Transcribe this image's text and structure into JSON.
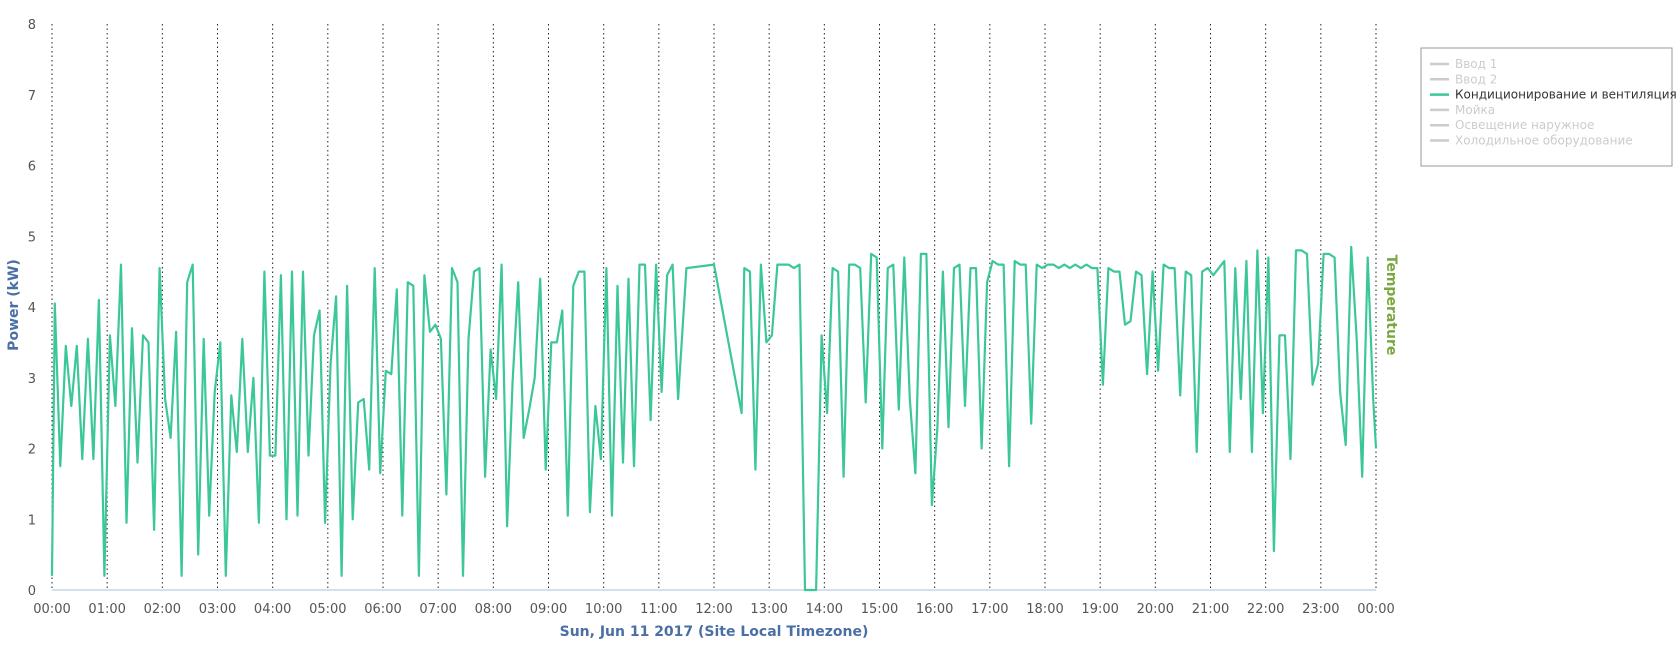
{
  "chart_data": {
    "type": "line",
    "xlabel": "Sun, Jun 11 2017 (Site Local Timezone)",
    "ylabel": "Power (kW)",
    "y2label": "Temperature",
    "ylim": [
      0,
      8
    ],
    "yticks": [
      "0",
      "1",
      "2",
      "3",
      "4",
      "5",
      "6",
      "7",
      "8"
    ],
    "xticks": [
      "00:00",
      "01:00",
      "02:00",
      "03:00",
      "04:00",
      "05:00",
      "06:00",
      "07:00",
      "08:00",
      "09:00",
      "10:00",
      "11:00",
      "12:00",
      "13:00",
      "14:00",
      "15:00",
      "16:00",
      "17:00",
      "18:00",
      "19:00",
      "20:00",
      "21:00",
      "22:00",
      "23:00",
      "00:00"
    ],
    "xlim_hours": [
      0,
      24
    ],
    "grid": "vertical dotted at each hour",
    "legend": {
      "position": "top-right",
      "entries": [
        {
          "name": "Ввод 1",
          "active": false
        },
        {
          "name": "Ввод 2",
          "active": false
        },
        {
          "name": "Кондиционирование и вентиляция",
          "active": true
        },
        {
          "name": "Мойка",
          "active": false
        },
        {
          "name": "Освещение наружное",
          "active": false
        },
        {
          "name": "Холодильное оборудование",
          "active": false
        }
      ]
    },
    "series": [
      {
        "name": "Кондиционирование и вентиляция",
        "color": "#3cc79a",
        "x_hours": [
          0.0,
          0.05,
          0.15,
          0.25,
          0.35,
          0.45,
          0.55,
          0.65,
          0.75,
          0.85,
          0.95,
          1.05,
          1.15,
          1.25,
          1.35,
          1.45,
          1.55,
          1.65,
          1.75,
          1.85,
          1.95,
          2.05,
          2.15,
          2.25,
          2.35,
          2.45,
          2.55,
          2.65,
          2.75,
          2.85,
          2.95,
          3.05,
          3.15,
          3.25,
          3.35,
          3.45,
          3.55,
          3.65,
          3.75,
          3.85,
          3.95,
          4.05,
          4.15,
          4.25,
          4.35,
          4.45,
          4.55,
          4.65,
          4.75,
          4.85,
          4.95,
          5.05,
          5.15,
          5.25,
          5.35,
          5.45,
          5.55,
          5.65,
          5.75,
          5.85,
          5.95,
          6.05,
          6.15,
          6.25,
          6.35,
          6.45,
          6.55,
          6.65,
          6.75,
          6.85,
          6.95,
          7.05,
          7.15,
          7.25,
          7.35,
          7.45,
          7.55,
          7.65,
          7.75,
          7.85,
          7.95,
          8.05,
          8.15,
          8.25,
          8.35,
          8.45,
          8.55,
          8.65,
          8.75,
          8.85,
          8.95,
          9.05,
          9.15,
          9.25,
          9.35,
          9.45,
          9.55,
          9.65,
          9.75,
          9.85,
          9.95,
          10.05,
          10.15,
          10.25,
          10.35,
          10.45,
          10.55,
          10.65,
          10.75,
          10.85,
          10.95,
          11.05,
          11.15,
          11.25,
          11.35,
          11.5,
          12.0,
          12.5,
          12.55,
          12.65,
          12.75,
          12.85,
          12.95,
          13.05,
          13.15,
          13.25,
          13.35,
          13.45,
          13.55,
          13.65,
          13.75,
          13.85,
          13.95,
          14.05,
          14.15,
          14.25,
          14.35,
          14.45,
          14.55,
          14.65,
          14.75,
          14.85,
          14.95,
          15.05,
          15.15,
          15.25,
          15.35,
          15.45,
          15.55,
          15.65,
          15.75,
          15.85,
          15.95,
          16.05,
          16.15,
          16.25,
          16.35,
          16.45,
          16.55,
          16.65,
          16.75,
          16.85,
          16.95,
          17.05,
          17.15,
          17.25,
          17.35,
          17.45,
          17.55,
          17.65,
          17.75,
          17.85,
          17.95,
          18.05,
          18.15,
          18.25,
          18.35,
          18.45,
          18.55,
          18.65,
          18.75,
          18.85,
          18.95,
          19.05,
          19.15,
          19.25,
          19.35,
          19.45,
          19.55,
          19.65,
          19.75,
          19.85,
          19.95,
          20.05,
          20.15,
          20.25,
          20.35,
          20.45,
          20.55,
          20.65,
          20.75,
          20.85,
          20.95,
          21.05,
          21.15,
          21.25,
          21.35,
          21.45,
          21.55,
          21.65,
          21.75,
          21.85,
          21.95,
          22.05,
          22.15,
          22.25,
          22.35,
          22.45,
          22.55,
          22.65,
          22.75,
          22.85,
          22.95,
          23.05,
          23.15,
          23.25,
          23.35,
          23.45,
          23.55,
          23.65,
          23.75,
          23.85,
          23.95,
          24.0
        ],
        "values": [
          0.2,
          4.05,
          1.75,
          3.45,
          2.6,
          3.45,
          1.85,
          3.55,
          1.85,
          4.1,
          0.2,
          3.6,
          2.6,
          4.6,
          0.95,
          3.7,
          1.8,
          3.6,
          3.5,
          0.85,
          4.55,
          2.7,
          2.15,
          3.65,
          0.2,
          4.35,
          4.6,
          0.5,
          3.55,
          1.05,
          2.8,
          3.5,
          0.2,
          2.75,
          1.95,
          3.55,
          1.95,
          3.0,
          0.95,
          4.5,
          1.9,
          1.9,
          4.45,
          1.0,
          4.5,
          1.05,
          4.5,
          1.9,
          3.6,
          3.95,
          0.95,
          3.2,
          4.15,
          0.2,
          4.3,
          1.0,
          2.65,
          2.7,
          1.7,
          4.55,
          1.65,
          3.1,
          3.05,
          4.25,
          1.05,
          4.35,
          4.3,
          0.2,
          4.45,
          3.65,
          3.75,
          3.55,
          1.35,
          4.55,
          4.35,
          0.2,
          3.55,
          4.5,
          4.55,
          1.6,
          3.4,
          2.7,
          4.6,
          0.9,
          2.95,
          4.35,
          2.15,
          2.55,
          3.0,
          4.4,
          1.7,
          3.5,
          3.5,
          3.95,
          1.05,
          4.3,
          4.5,
          4.5,
          1.1,
          2.6,
          1.85,
          4.55,
          1.05,
          4.3,
          1.8,
          4.4,
          1.75,
          4.6,
          4.6,
          2.4,
          4.6,
          2.8,
          4.45,
          4.6,
          2.7,
          4.55,
          4.6,
          2.5,
          4.55,
          4.5,
          1.7,
          4.6,
          3.5,
          3.6,
          4.6,
          4.6,
          4.6,
          4.55,
          4.6,
          0.0,
          0.0,
          0.0,
          3.6,
          2.5,
          4.55,
          4.5,
          1.6,
          4.6,
          4.6,
          4.55,
          2.65,
          4.75,
          4.7,
          2.0,
          4.55,
          4.6,
          2.55,
          4.7,
          2.7,
          1.65,
          4.75,
          4.75,
          1.2,
          2.3,
          4.5,
          2.3,
          4.55,
          4.6,
          2.6,
          4.55,
          4.55,
          2.0,
          4.35,
          4.65,
          4.6,
          4.6,
          1.75,
          4.65,
          4.6,
          4.6,
          2.35,
          4.6,
          4.55,
          4.6,
          4.6,
          4.55,
          4.6,
          4.55,
          4.6,
          4.55,
          4.6,
          4.55,
          4.55,
          2.9,
          4.55,
          4.5,
          4.5,
          3.75,
          3.8,
          4.5,
          4.45,
          3.05,
          4.5,
          3.1,
          4.6,
          4.55,
          4.55,
          2.75,
          4.5,
          4.45,
          1.95,
          4.5,
          4.55,
          4.45,
          4.55,
          4.65,
          1.95,
          4.55,
          2.7,
          4.65,
          1.95,
          4.8,
          2.5,
          4.7,
          0.55,
          3.6,
          3.6,
          1.85,
          4.8,
          4.8,
          4.75,
          2.9,
          3.2,
          4.75,
          4.75,
          4.7,
          2.8,
          2.05,
          4.85,
          3.55,
          1.6,
          4.7,
          2.7,
          2.0,
          2.8,
          4.85,
          4.75,
          2.3,
          4.35,
          1.8,
          4.6,
          4.6,
          1.0,
          4.65,
          3.05,
          4.45,
          2.55,
          3.2,
          4.6
        ]
      }
    ]
  }
}
